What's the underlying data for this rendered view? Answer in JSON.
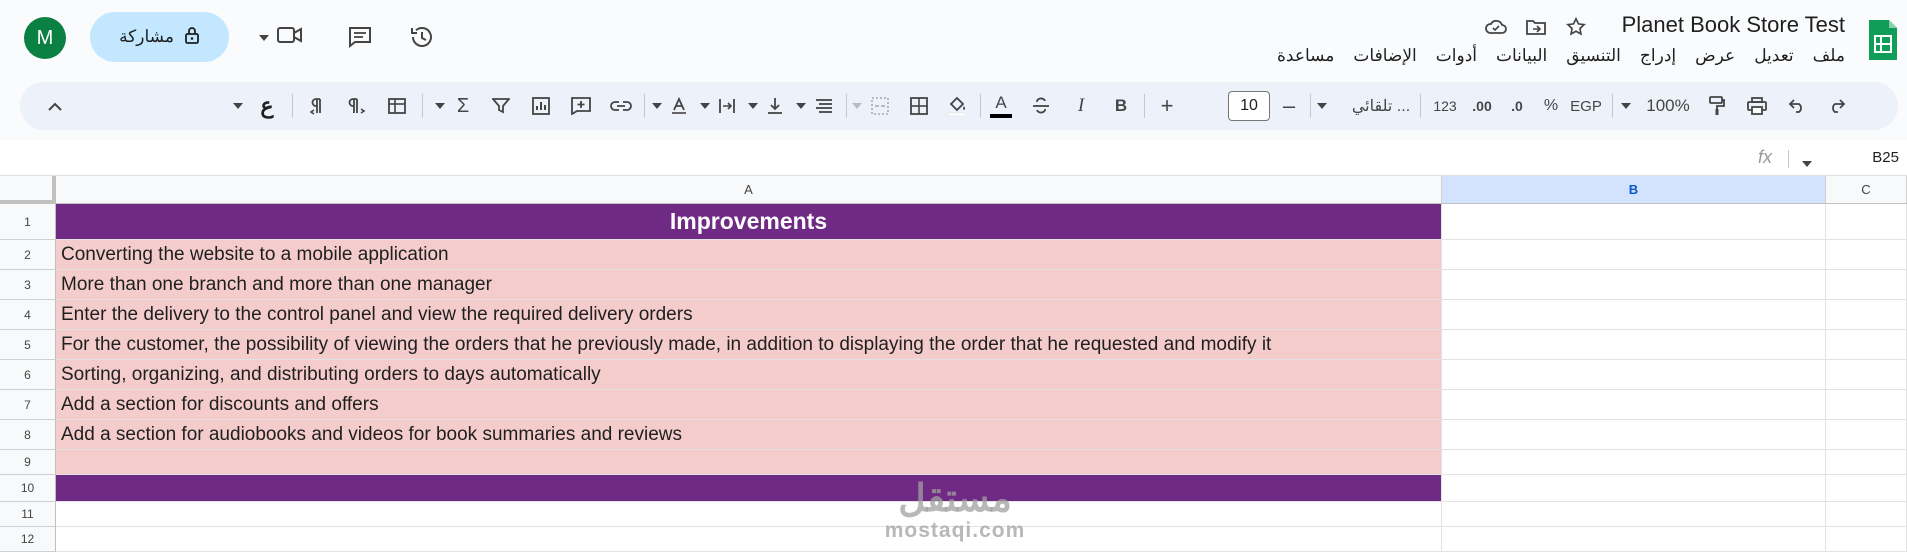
{
  "header": {
    "title": "Planet Book Store Test",
    "menus": [
      "ملف",
      "تعديل",
      "عرض",
      "إدراج",
      "التنسيق",
      "البيانات",
      "أدوات",
      "الإضافات",
      "مساعدة"
    ],
    "share_label": "مشاركة",
    "avatar_letter": "M"
  },
  "toolbar": {
    "zoom": "100%",
    "currency": "EGP",
    "percent": "%",
    "decimal_decrease": ".0",
    "decimal_increase": ".00",
    "number_format": "123",
    "font": "تلقائي ...",
    "font_size": "10",
    "minus": "–",
    "plus": "+",
    "bold": "B",
    "italic": "I",
    "text_color_letter": "A",
    "sigma": "Σ",
    "input_tools": "ع"
  },
  "formula_bar": {
    "cell_ref": "B25",
    "fx": "fx"
  },
  "sheet": {
    "columns": [
      "A",
      "B",
      "C"
    ],
    "rows": [
      "1",
      "2",
      "3",
      "4",
      "5",
      "6",
      "7",
      "8",
      "9",
      "10",
      "11",
      "12"
    ],
    "cells_a": [
      "Improvements",
      "Converting the website to a mobile application",
      "More than one branch and more than one manager",
      "Enter the delivery to the control panel and view the required delivery orders",
      "For the customer, the possibility of viewing the orders that he previously made, in addition to displaying the order that he requested and modify it",
      "Sorting, organizing, and distributing orders to days automatically",
      "Add a section for discounts and offers",
      "Add a section for audiobooks and videos for book summaries and reviews",
      "",
      "",
      "",
      ""
    ]
  },
  "watermark": {
    "arabic": "مستقل",
    "latin": "mostaqi.com"
  },
  "colors": {
    "purple": "#6f2a84",
    "pink": "#f4cccc",
    "selected_header": "#d3e3fd",
    "share": "#c2e7ff",
    "avatar": "#0b8043"
  }
}
